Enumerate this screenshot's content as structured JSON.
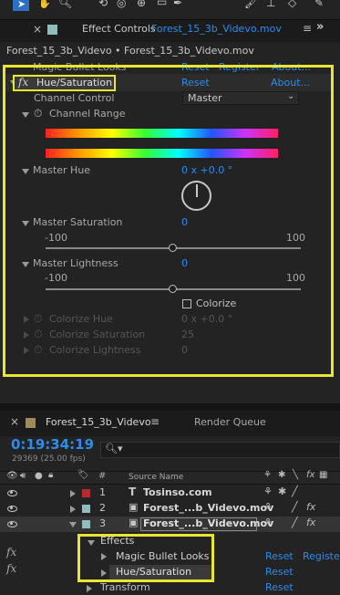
{
  "effect_controls": {
    "tab_label": "Effect Controls",
    "tab_file": "Forest_15_3b_Videvo.mov",
    "breadcrumb": "Forest_15_3b_Videvo • Forest_15_3b_Videvo.mov",
    "cut_effect": {
      "name": "Magic Bullet Looks",
      "reset": "Reset",
      "register": "Register",
      "about": "About..."
    },
    "effect": {
      "fx": "fx",
      "name": "Hue/Saturation",
      "reset": "Reset",
      "about": "About..."
    },
    "channel_control": {
      "label": "Channel Control",
      "value": "Master"
    },
    "channel_range": {
      "label": "Channel Range"
    },
    "master_hue": {
      "label": "Master Hue",
      "value": "0 x +0.0 °"
    },
    "master_saturation": {
      "label": "Master Saturation",
      "value": "0",
      "min": "-100",
      "max": "100",
      "level": 0.5
    },
    "master_lightness": {
      "label": "Master Lightness",
      "value": "0",
      "min": "-100",
      "max": "100",
      "level": 0.5
    },
    "colorize": {
      "label": "Colorize",
      "checked": false
    },
    "colorize_hue": {
      "label": "Colorize Hue",
      "value": "0 x +0.0 °"
    },
    "colorize_saturation": {
      "label": "Colorize Saturation",
      "value": "25"
    },
    "colorize_lightness": {
      "label": "Colorize Lightness",
      "value": "0"
    }
  },
  "timeline": {
    "comp_tab": "Forest_15_3b_Videvo",
    "render_queue_tab": "Render Queue",
    "timecode": "0:19:34:19",
    "frame_info": "29369 (25.00 fps)",
    "search_placeholder": "",
    "columns": {
      "number": "#",
      "source_name": "Source Name"
    },
    "layers": [
      {
        "index": "1",
        "name": "Tosinso.com",
        "color": "#b52a2a"
      },
      {
        "index": "2",
        "name": "Forest_...b_Videvo.mov",
        "color": "#8fbcbc"
      },
      {
        "index": "3",
        "name": "Forest_...b_Videvo.mov",
        "color": "#8fbcbc"
      }
    ],
    "effects_group": "Effects",
    "effect_rows": [
      {
        "name": "Magic Bullet Looks",
        "reset": "Reset",
        "register": "Register"
      },
      {
        "name": "Hue/Saturation",
        "reset": "Reset"
      }
    ],
    "transform_row": {
      "name": "Transform",
      "reset": "Reset"
    }
  },
  "colors": {
    "accent": "#2d8ceb",
    "highlight": "#e8e632",
    "panel": "#232323"
  }
}
